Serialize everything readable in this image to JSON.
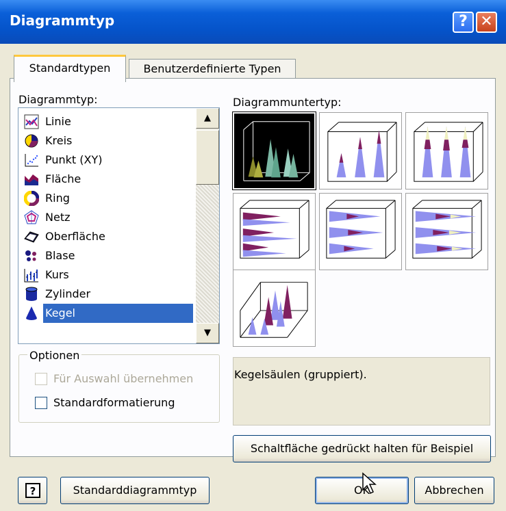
{
  "window": {
    "title": "Diagrammtyp"
  },
  "tabs": [
    {
      "label": "Standardtypen",
      "active": true
    },
    {
      "label": "Benutzerdefinierte Typen",
      "active": false
    }
  ],
  "chart_type_list": {
    "label": "Diagrammtyp:",
    "items": [
      {
        "label": "Linie",
        "icon": "line-chart-icon"
      },
      {
        "label": "Kreis",
        "icon": "pie-chart-icon"
      },
      {
        "label": "Punkt (XY)",
        "icon": "scatter-chart-icon"
      },
      {
        "label": "Fläche",
        "icon": "area-chart-icon"
      },
      {
        "label": "Ring",
        "icon": "doughnut-chart-icon"
      },
      {
        "label": "Netz",
        "icon": "radar-chart-icon"
      },
      {
        "label": "Oberfläche",
        "icon": "surface-chart-icon"
      },
      {
        "label": "Blase",
        "icon": "bubble-chart-icon"
      },
      {
        "label": "Kurs",
        "icon": "stock-chart-icon"
      },
      {
        "label": "Zylinder",
        "icon": "cylinder-chart-icon"
      },
      {
        "label": "Kegel",
        "icon": "cone-chart-icon",
        "selected": true
      }
    ]
  },
  "subtype": {
    "label": "Diagrammuntertyp:",
    "selected_index": 0,
    "count": 7
  },
  "options": {
    "legend": "Optionen",
    "apply_to_selection": {
      "label": "Für Auswahl übernehmen",
      "checked": false,
      "disabled": true
    },
    "default_formatting": {
      "label": "Standardformatierung",
      "checked": false,
      "disabled": false
    }
  },
  "description": "Kegelsäulen (gruppiert).",
  "buttons": {
    "preview": "Schaltfläche gedrückt halten für Beispiel",
    "set_default": "Standarddiagrammtyp",
    "ok": "OK",
    "cancel": "Abbrechen"
  },
  "colors": {
    "title_bar": "#0a5fd8",
    "selection": "#316ac5",
    "face": "#ece9d8"
  }
}
